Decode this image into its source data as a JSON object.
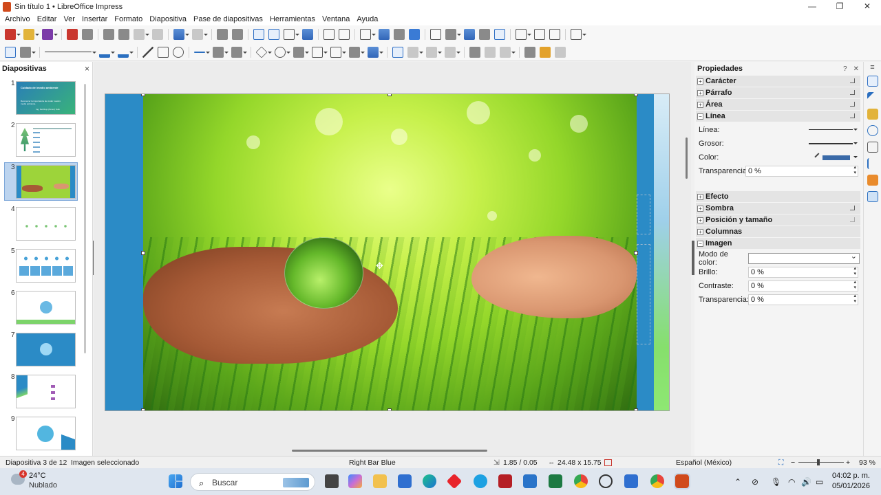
{
  "window": {
    "title": "Sin título 1 • LibreOffice Impress",
    "minimize": "—",
    "maximize": "❐",
    "close": "✕"
  },
  "menu": [
    "Archivo",
    "Editar",
    "Ver",
    "Insertar",
    "Formato",
    "Diapositiva",
    "Pase de diapositivas",
    "Herramientas",
    "Ventana",
    "Ayuda"
  ],
  "slides_panel": {
    "title": "Diapositivas",
    "close": "×",
    "selected": 3,
    "thumbs": [
      {
        "num": "1",
        "title_text": "Cuidado del medio ambiente",
        "subtitle_text": "Reconocer la importancia de cuidar nuestro medio ambiente.",
        "author_text": "Ing. Del Rojo (Pérez) Tello"
      },
      {
        "num": "2"
      },
      {
        "num": "3"
      },
      {
        "num": "4"
      },
      {
        "num": "5"
      },
      {
        "num": "6"
      },
      {
        "num": "7"
      },
      {
        "num": "8"
      },
      {
        "num": "9"
      }
    ]
  },
  "properties": {
    "title": "Propiedades",
    "help": "?",
    "close": "✕",
    "menu": "≡",
    "sections_top": [
      "Carácter",
      "Párrafo",
      "Área",
      "Línea"
    ],
    "line_rows": {
      "linea": "Línea:",
      "grosor": "Grosor:",
      "color": "Color:",
      "transparencia": "Transparencia:",
      "transparencia_value": "0 %"
    },
    "sections_bottom": [
      "Efecto",
      "Sombra",
      "Posición y tamaño",
      "Columnas",
      "Imagen"
    ],
    "image_rows": {
      "modo_color": "Modo de color:",
      "brillo": "Brillo:",
      "brillo_value": "0 %",
      "contraste": "Contraste:",
      "contraste_value": "0 %",
      "transparencia": "Transparencia:",
      "transparencia_value": "0 %"
    }
  },
  "status": {
    "slide": "Diapositiva 3 de 12",
    "selection": "Imagen seleccionado",
    "master": "Right Bar Blue",
    "position": "1.85 / 0.05",
    "size": "24.48 x 15.75",
    "language": "Español (México)",
    "zoom_minus": "−",
    "zoom_plus": "+",
    "zoom": "93 %"
  },
  "taskbar": {
    "weather_badge": "4",
    "temperature": "24°C",
    "weather": "Nublado",
    "search_placeholder": "Buscar",
    "time": "04:02 p. m.",
    "date": "05/01/2026"
  },
  "colors": {
    "accent": "#2b8bc6",
    "selection": "#bcd4ef",
    "line_color": "#3a6aa8"
  }
}
